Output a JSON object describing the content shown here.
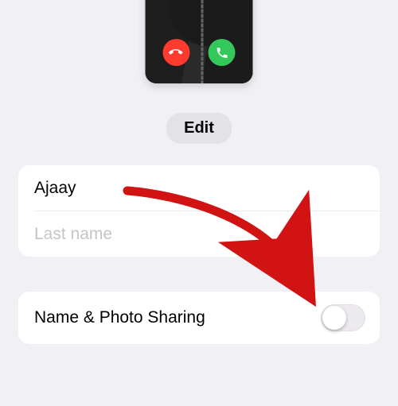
{
  "edit_label": "Edit",
  "name": {
    "first": "Ajaay",
    "last_placeholder": "Last name"
  },
  "sharing": {
    "label": "Name & Photo Sharing",
    "enabled": false
  },
  "icons": {
    "decline": "phone-decline-icon",
    "accept": "phone-accept-icon"
  }
}
